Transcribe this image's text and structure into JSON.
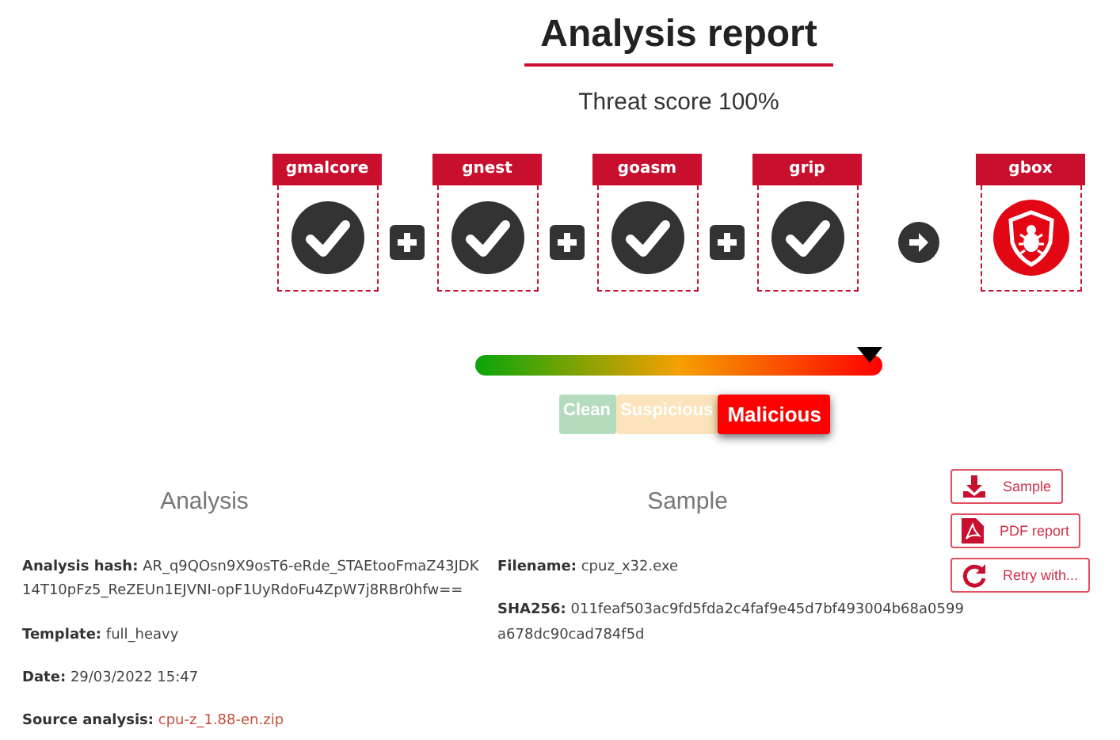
{
  "title": "Analysis report",
  "threat_score": "Threat score 100%",
  "pipeline": [
    {
      "kind": "engine",
      "name": "gmalcore",
      "threat_detected": false
    },
    {
      "kind": "plus"
    },
    {
      "kind": "engine",
      "name": "gnest",
      "threat_detected": false
    },
    {
      "kind": "plus"
    },
    {
      "kind": "engine",
      "name": "goasm",
      "threat_detected": false
    },
    {
      "kind": "plus"
    },
    {
      "kind": "engine",
      "name": "grip",
      "threat_detected": false
    },
    {
      "kind": "arrow"
    },
    {
      "kind": "engine",
      "name": "gbox",
      "threat_detected": true
    }
  ],
  "threat_meter": {
    "level": 0.97
  },
  "verdicts": [
    {
      "label": "Clean",
      "kind": "clean",
      "selected": false
    },
    {
      "label": "Suspicious",
      "kind": "suspicious",
      "selected": false
    },
    {
      "label": "Malicious",
      "kind": "malicious",
      "selected": true
    }
  ],
  "analysis": {
    "heading": "Analysis",
    "fields": [
      {
        "label": "Analysis hash:",
        "value": "AR_q9QOsn9X9osT6-eRde_STAEtooFmaZ43JDK 14T10pFz5_ReZEUn1EJVNI-opF1UyRdoFu4ZpW7j8RBr0hfw=="
      },
      {
        "label": "Template:",
        "value": "full_heavy"
      },
      {
        "label": "Date:",
        "value": "29/03/2022 15:47"
      },
      {
        "label": "Source analysis:",
        "value": "cpu-z_1.88-en.zip",
        "kind": "link"
      }
    ]
  },
  "sample": {
    "heading": "Sample",
    "fields": [
      {
        "label": "Filename:",
        "value": "cpuz_x32.exe"
      },
      {
        "label": "SHA256:",
        "value": "011feaf503ac9fd5fda2c4faf9e45d7bf493004b68a0599 a678dc90cad784f5d"
      }
    ]
  },
  "actions": [
    {
      "label": "Sample",
      "kind": "download"
    },
    {
      "label": "PDF report",
      "kind": "pdf"
    },
    {
      "label": "Retry with...",
      "kind": "retry"
    }
  ]
}
